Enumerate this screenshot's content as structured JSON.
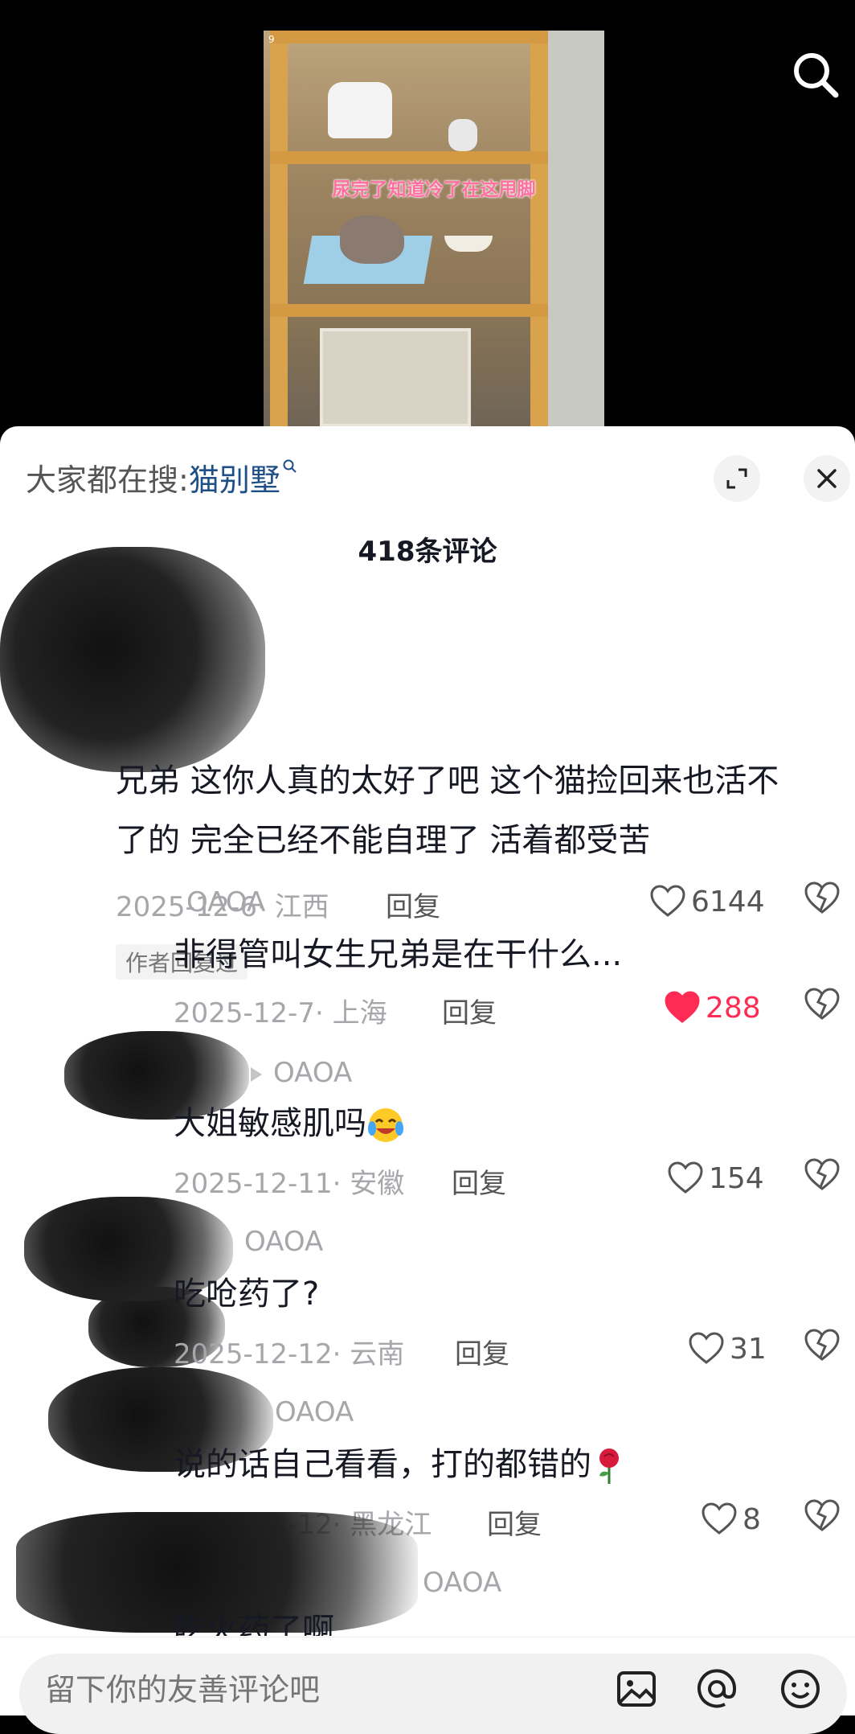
{
  "video": {
    "caption": "尿完了知道冷了在这甩脚",
    "frame_tag": "9"
  },
  "sheet": {
    "suggest_label": "大家都在搜:",
    "suggest_term": "猫别墅",
    "comment_count": "418条评论"
  },
  "comments": [
    {
      "text": "兄弟 这你人真的太好了吧 这个猫捡回来也活不\n了的 完全已经不能自理了 活着都受苦",
      "date_loc": "2025-12-6· 江西",
      "reply": "回复",
      "likes": "6144",
      "liked": false,
      "badge": "作者回复过"
    },
    {
      "user": "OAOA",
      "text": "非得管叫女生兄弟是在干什么...",
      "date_loc": "2025-12-7· 上海",
      "reply": "回复",
      "likes": "288",
      "liked": true
    },
    {
      "user": "OAOA",
      "text": "大姐敏感肌吗",
      "date_loc": "2025-12-11· 安徽",
      "reply": "回复",
      "likes": "154",
      "liked": false
    },
    {
      "user": "OAOA",
      "text": "吃呛药了?",
      "date_loc": "2025-12-12· 云南",
      "reply": "回复",
      "likes": "31",
      "liked": false
    },
    {
      "user": "OAOA",
      "text": "说的话自己看看，打的都错的",
      "date_loc": "2025-12-12· 黑龙江",
      "reply": "回复",
      "likes": "8",
      "liked": false
    },
    {
      "user": "OAOA",
      "text": "吃火药了啊"
    }
  ],
  "input": {
    "placeholder": "留下你的友善评论吧"
  },
  "colors": {
    "accent_like": "#fe2c55",
    "link": "#1f4f87"
  },
  "icons": [
    "search-icon",
    "expand-icon",
    "close-icon",
    "heart-icon",
    "dislike-icon",
    "image-icon",
    "at-icon",
    "emoji-icon",
    "laughing-tears-emoji",
    "rose-emoji"
  ]
}
